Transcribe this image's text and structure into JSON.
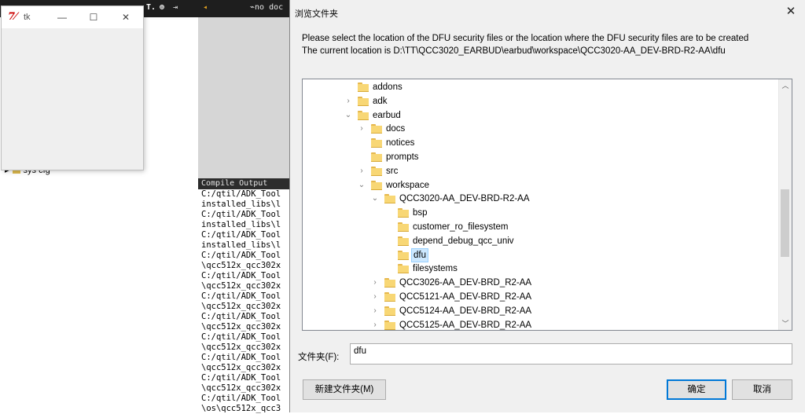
{
  "ide": {
    "toolbar": [
      "T.",
      "⊕",
      "⇥",
      "◂",
      "⌁no  doc"
    ],
    "tree_item": "sys cfg",
    "output_header": "Compile Output",
    "output_lines": [
      "C:/qtil/ADK_Tool",
      "installed_libs\\l",
      "C:/qtil/ADK_Tool",
      "installed_libs\\l",
      "C:/qtil/ADK_Tool",
      "installed_libs\\l",
      "C:/qtil/ADK_Tool",
      "\\qcc512x_qcc302x",
      "C:/qtil/ADK_Tool",
      "\\qcc512x_qcc302x",
      "C:/qtil/ADK_Tool",
      "\\qcc512x_qcc302x",
      "C:/qtil/ADK_Tool",
      "\\qcc512x_qcc302x",
      "C:/qtil/ADK_Tool",
      "\\qcc512x_qcc302x",
      "C:/qtil/ADK_Tool",
      "\\qcc512x_qcc302x",
      "C:/qtil/ADK_Tool",
      "\\qcc512x_qcc302x",
      "C:/qtil/ADK_Tool",
      "\\os\\qcc512x_qcc3"
    ]
  },
  "tk_window": {
    "logo": "7⁄",
    "title": "tk",
    "minimize": "—",
    "maximize": "☐",
    "close": "✕"
  },
  "dialog": {
    "title": "浏览文件夹",
    "close": "✕",
    "line1": "Please select the location of the DFU security files or the location where the DFU security files are to be created",
    "line2": "The current location is D:\\TT\\QCC3020_EARBUD\\earbud\\workspace\\QCC3020-AA_DEV-BRD-R2-AA\\dfu",
    "tree": [
      {
        "label": "addons",
        "twisty": ""
      },
      {
        "label": "adk",
        "twisty": "›"
      },
      {
        "label": "earbud",
        "twisty": "⌄"
      },
      {
        "label": "docs",
        "twisty": "›"
      },
      {
        "label": "notices",
        "twisty": ""
      },
      {
        "label": "prompts",
        "twisty": ""
      },
      {
        "label": "src",
        "twisty": "›"
      },
      {
        "label": "workspace",
        "twisty": "⌄"
      },
      {
        "label": "QCC3020-AA_DEV-BRD-R2-AA",
        "twisty": "⌄"
      },
      {
        "label": "bsp",
        "twisty": ""
      },
      {
        "label": "customer_ro_filesystem",
        "twisty": ""
      },
      {
        "label": "depend_debug_qcc_univ",
        "twisty": ""
      },
      {
        "label": "dfu",
        "twisty": "",
        "selected": true
      },
      {
        "label": "filesystems",
        "twisty": ""
      },
      {
        "label": "QCC3026-AA_DEV-BRD_R2-AA",
        "twisty": "›"
      },
      {
        "label": "QCC5121-AA_DEV-BRD_R2-AA",
        "twisty": "›"
      },
      {
        "label": "QCC5124-AA_DEV-BRD_R2-AA",
        "twisty": "›"
      },
      {
        "label": "QCC5125-AA_DEV-BRD_R2-AA",
        "twisty": "›"
      }
    ],
    "scroll_up": "︿",
    "scroll_down": "﹀",
    "folder_label": "文件夹(F):",
    "folder_value": "dfu",
    "new_folder_button": "新建文件夹(M)",
    "ok_button": "确定",
    "cancel_button": "取消"
  }
}
